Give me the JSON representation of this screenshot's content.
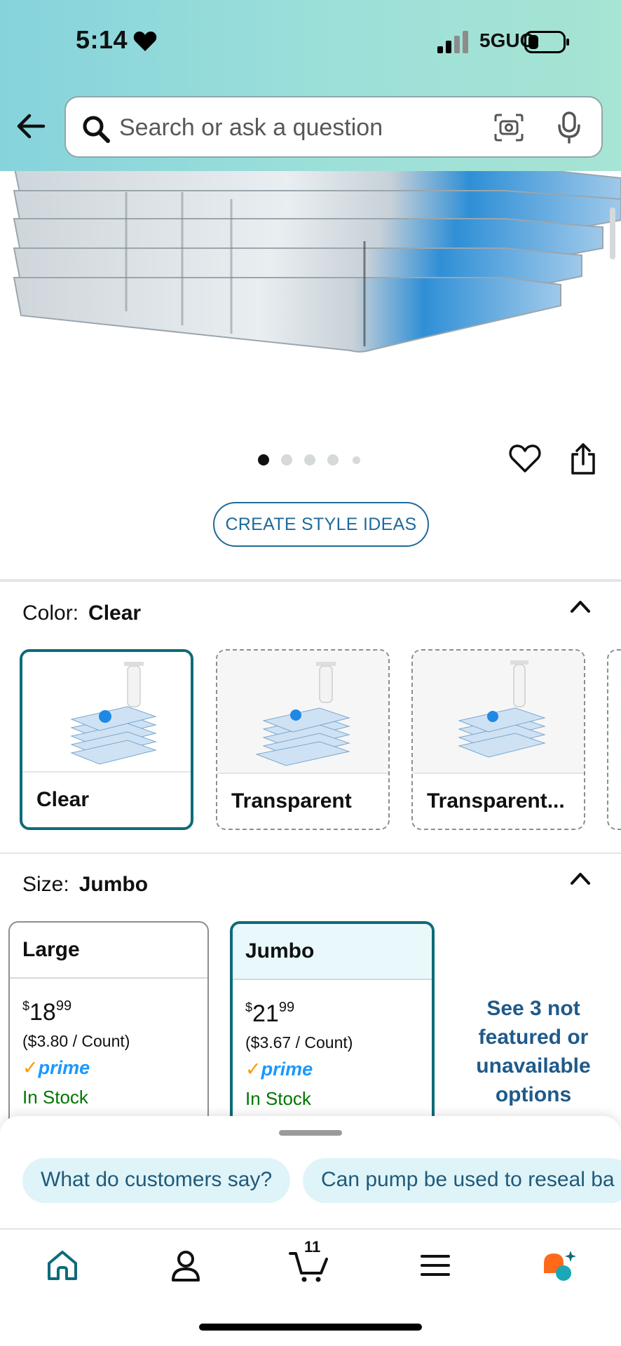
{
  "status_bar": {
    "time": "5:14",
    "network": "5GUC",
    "icons": [
      "heart-icon",
      "signal-icon",
      "battery-icon"
    ]
  },
  "search": {
    "placeholder": "Search or ask a question",
    "icons": [
      "back-arrow-icon",
      "search-icon",
      "camera-icon",
      "microphone-icon"
    ]
  },
  "gallery": {
    "image_count": 5,
    "active_index": 0
  },
  "actions": {
    "create_style_ideas": "CREATE STYLE IDEAS",
    "icons": [
      "heart-outline-icon",
      "share-icon"
    ]
  },
  "color": {
    "label": "Color:",
    "selected": "Clear",
    "options": [
      {
        "label": "Clear",
        "selected": true
      },
      {
        "label": "Transparent",
        "selected": false
      },
      {
        "label": "Transparent...",
        "selected": false
      }
    ]
  },
  "size": {
    "label": "Size:",
    "selected": "Jumbo",
    "options": [
      {
        "name": "Large",
        "price_currency": "$",
        "price_whole": "18",
        "price_cents": "99",
        "unit_price": "($3.80 / Count)",
        "prime": "prime",
        "stock": "In Stock",
        "selected": false
      },
      {
        "name": "Jumbo",
        "price_currency": "$",
        "price_whole": "21",
        "price_cents": "99",
        "unit_price": "($3.67 / Count)",
        "prime": "prime",
        "stock": "In Stock",
        "selected": true
      }
    ],
    "see_more": "See 3 not featured or unavailable options"
  },
  "questions": {
    "chips": [
      "What do customers say?",
      "Can pump be used to reseal ba"
    ]
  },
  "tab_bar": {
    "cart_count": "11",
    "tabs": [
      "home-icon",
      "account-icon",
      "cart-icon",
      "menu-icon",
      "rufus-icon"
    ]
  },
  "colors": {
    "accent_teal": "#0d6b7a",
    "link_blue": "#1f6b9a",
    "prime_blue": "#1a98ff",
    "stock_green": "#007600"
  }
}
